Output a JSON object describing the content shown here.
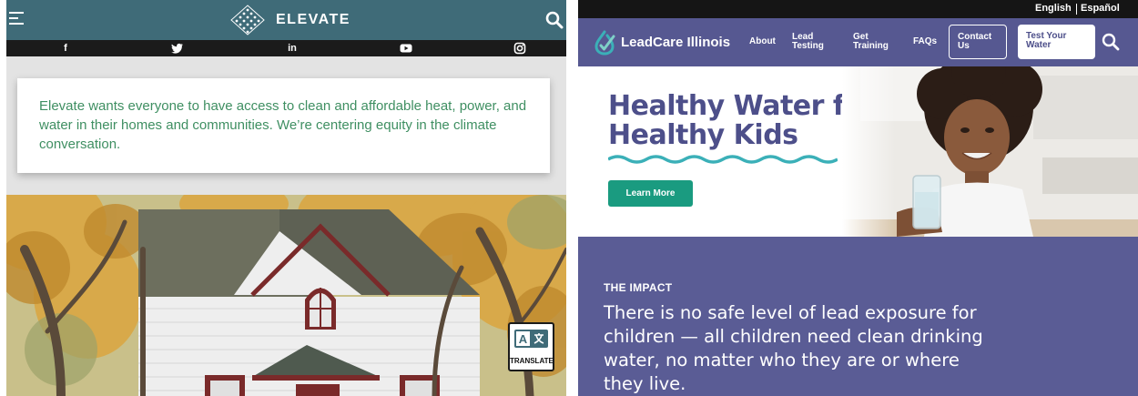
{
  "elevate": {
    "brand": "ELEVATE",
    "icons": {
      "menu": "hamburger-menu-icon",
      "logo": "diamond-logo-icon",
      "search": "search-icon",
      "translate": "translate-icon"
    },
    "social": [
      {
        "name": "facebook-icon",
        "glyph": "f"
      },
      {
        "name": "twitter-icon",
        "glyph": "🐦"
      },
      {
        "name": "linkedin-icon",
        "glyph": "in"
      },
      {
        "name": "youtube-icon",
        "glyph": "▶"
      },
      {
        "name": "instagram-icon",
        "glyph": "◎"
      }
    ],
    "mission": "Elevate wants everyone to have access to clean and affordable heat, power, and water in their homes and communities. We’re centering equity in the climate conversation.",
    "translate_label": "TRANSLATE",
    "colors": {
      "header": "#3f6b78",
      "social_bar": "#1b1b1b",
      "mission_text": "#3f8f62"
    }
  },
  "leadcare": {
    "languages": [
      "English",
      "Español"
    ],
    "brand": "LeadCare Illinois",
    "nav": {
      "about": "About",
      "lead_testing": "Lead Testing",
      "get_training": "Get Training",
      "faqs": "FAQs",
      "contact": "Contact Us",
      "test_water": "Test Your Water"
    },
    "hero": {
      "title": "Healthy Water for Healthy Kids",
      "cta": "Learn More"
    },
    "impact": {
      "eyebrow": "THE IMPACT",
      "text": "There is no safe level of lead exposure for children — all children need clean drinking water, no matter who they are or where they live."
    },
    "icons": {
      "logo": "water-drop-check-icon",
      "search": "search-icon"
    },
    "colors": {
      "nav": "#565891",
      "brand_purple": "#4d4f8a",
      "teal": "#3bb0b8",
      "cta": "#1a9b80",
      "impact_bg": "#5a5c95"
    }
  }
}
